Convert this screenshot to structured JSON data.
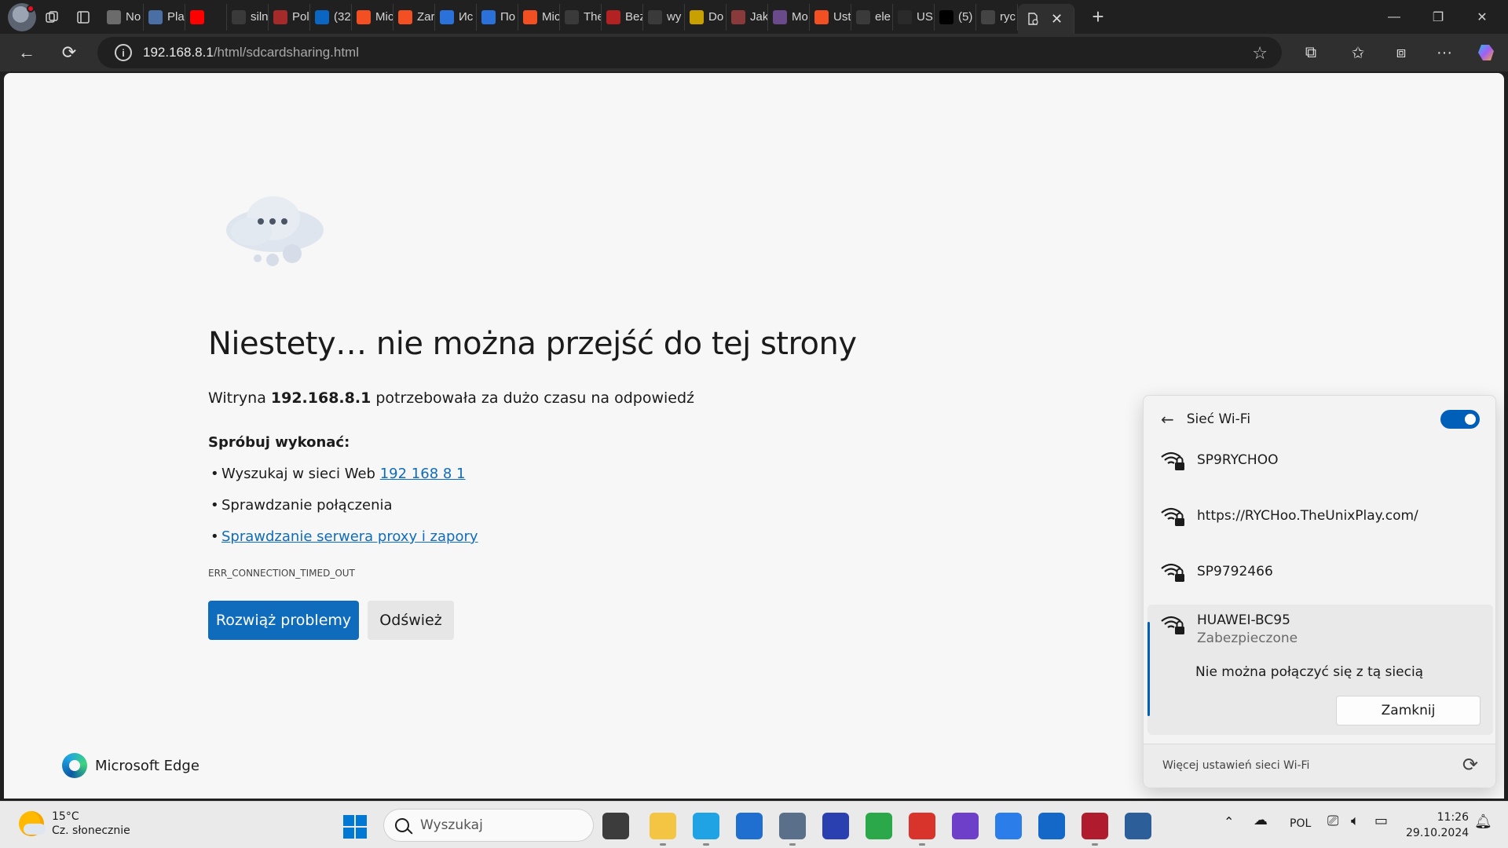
{
  "browser": {
    "tabs": [
      {
        "label": "No",
        "color": "#6b6b6b"
      },
      {
        "label": "Pla",
        "color": "#4a6fa5"
      },
      {
        "label": "",
        "color": "#ff0000"
      },
      {
        "label": "siln",
        "color": "#3a3a3a"
      },
      {
        "label": "Pol",
        "color": "#a52a2a"
      },
      {
        "label": "(32",
        "color": "#0a66c2"
      },
      {
        "label": "Mic",
        "color": "#f25022"
      },
      {
        "label": "Zar",
        "color": "#f25022"
      },
      {
        "label": "Иc",
        "color": "#2a72d9"
      },
      {
        "label": "По",
        "color": "#2a72d9"
      },
      {
        "label": "Mic",
        "color": "#f25022"
      },
      {
        "label": "The",
        "color": "#3a3a3a"
      },
      {
        "label": "Bez",
        "color": "#b22222"
      },
      {
        "label": "wy",
        "color": "#3a3a3a"
      },
      {
        "label": "Do",
        "color": "#c8a000"
      },
      {
        "label": "Jak",
        "color": "#8a3a3a"
      },
      {
        "label": "Mo",
        "color": "#6a4a8a"
      },
      {
        "label": "Ust",
        "color": "#f25022"
      },
      {
        "label": "ele",
        "color": "#3a3a3a"
      },
      {
        "label": "US",
        "color": "#2a2a2a"
      },
      {
        "label": "(5)",
        "color": "#000000"
      },
      {
        "label": "ryc",
        "color": "#444444"
      }
    ],
    "active_tab_icon": "page-error-icon",
    "url_host": "192.168.8.1",
    "url_path": "/html/sdcardsharing.html"
  },
  "error_page": {
    "title": "Niestety… nie można przejść do tej strony",
    "subtitle_prefix": "Witryna ",
    "subtitle_host": "192.168.8.1",
    "subtitle_suffix": " potrzebowała za dużo czasu na odpowiedź",
    "try_label": "Spróbuj wykonać:",
    "suggestion_1_prefix": "Wyszukaj w sieci Web ",
    "suggestion_1_link": "192 168 8 1",
    "suggestion_2": "Sprawdzanie połączenia",
    "suggestion_3_link": "Sprawdzanie serwera proxy i zapory",
    "error_code": "ERR_CONNECTION_TIMED_OUT",
    "troubleshoot_button": "Rozwiąż problemy",
    "refresh_button": "Odśwież",
    "brand": "Microsoft Edge"
  },
  "wifi_flyout": {
    "title": "Sieć Wi-Fi",
    "wifi_enabled": true,
    "networks": [
      {
        "name": "SP9RYCHOO",
        "secured": true
      },
      {
        "name": "https://RYCHoo.TheUnixPlay.com/",
        "secured": true
      },
      {
        "name": "SP9792466",
        "secured": true
      }
    ],
    "selected_network": {
      "name": "HUAWEI-BC95",
      "status": "Zabezpieczone",
      "message": "Nie można połączyć się z tą siecią",
      "close_button": "Zamknij"
    },
    "more_settings": "Więcej ustawień sieci Wi-Fi"
  },
  "taskbar": {
    "weather_temp": "15°C",
    "weather_desc": "Cz. słonecznie",
    "search_placeholder": "Wyszukaj",
    "language": "POL",
    "time": "11:26",
    "date": "29.10.2024",
    "apps": [
      {
        "name": "task-view",
        "color": "#3c3c3c"
      },
      {
        "name": "file-explorer",
        "color": "#f4c542"
      },
      {
        "name": "edge",
        "color": "#1fa3e4"
      },
      {
        "name": "microsoft-store",
        "color": "#1f6fd1"
      },
      {
        "name": "settings",
        "color": "#5a6f8a"
      },
      {
        "name": "save-app",
        "color": "#2a3fb0"
      },
      {
        "name": "globe-app",
        "color": "#2aa84a"
      },
      {
        "name": "red-app",
        "color": "#d8342c"
      },
      {
        "name": "github-desktop",
        "color": "#6e40c9"
      },
      {
        "name": "notepad",
        "color": "#2b7de9"
      },
      {
        "name": "shield-app",
        "color": "#1468c8"
      },
      {
        "name": "d-app",
        "color": "#b01c2e"
      },
      {
        "name": "virtualbox",
        "color": "#2c5f9a"
      }
    ]
  }
}
